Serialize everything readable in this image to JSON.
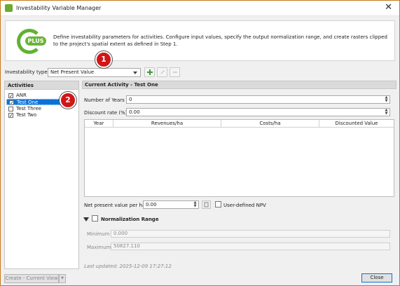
{
  "window": {
    "title": "Investability Variable Manager",
    "close_glyph": "✕"
  },
  "banner": {
    "logo_text": "PLUS",
    "description": "Define investability parameters for activities. Configure input values, specify the output normalization range, and create rasters clipped to the project's spatial extent as defined in Step 1."
  },
  "investability": {
    "label": "Investability type:",
    "value": "Net Present Value"
  },
  "toolbar_icons": [
    "add-icon",
    "edit-icon",
    "delete-icon"
  ],
  "activities": {
    "heading": "Activities",
    "items": [
      {
        "label": "ANR",
        "checked": true,
        "selected": false
      },
      {
        "label": "Test One",
        "checked": true,
        "selected": true
      },
      {
        "label": "Test Three",
        "checked": false,
        "selected": false
      },
      {
        "label": "Test Two",
        "checked": true,
        "selected": false
      }
    ]
  },
  "current": {
    "heading": "Current Activity - Test One",
    "years_label": "Number of Years",
    "years_value": "0",
    "discount_label": "Discount rate (%)",
    "discount_value": "0.00",
    "table_headers": [
      "Year",
      "Revenues/ha",
      "Costs/ha",
      "Discounted Value"
    ],
    "npv_label": "Net present value per ha",
    "npv_value": "0.00",
    "user_npv_label": "User-defined NPV",
    "norm_label": "Normalization Range",
    "min_label": "Minimum",
    "min_value": "0.000",
    "max_label": "Maximum",
    "max_value": "50827.110",
    "last_updated": "Last updated: 2025-12-09 17:27:12"
  },
  "footer": {
    "create_label": "Create - Current View",
    "close_label": "Close"
  },
  "annotations": [
    "1",
    "2"
  ],
  "colors": {
    "accent": "#0a73d8",
    "badge": "#d21515",
    "logo": "#62b133"
  }
}
